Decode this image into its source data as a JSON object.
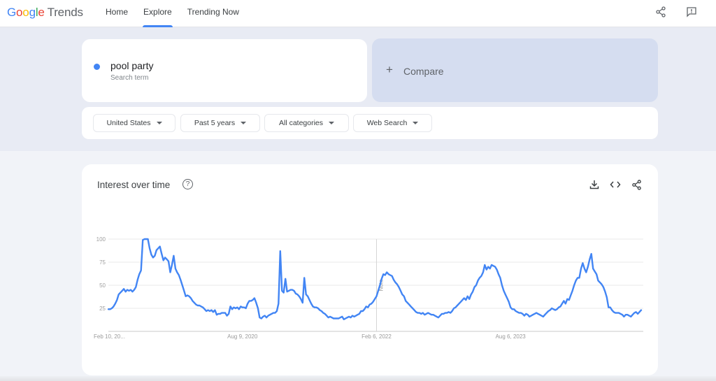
{
  "app": {
    "logo_google": [
      "G",
      "o",
      "o",
      "g",
      "l",
      "e"
    ],
    "logo_trends": "Trends"
  },
  "nav": {
    "items": [
      {
        "label": "Home",
        "active": false
      },
      {
        "label": "Explore",
        "active": true
      },
      {
        "label": "Trending Now",
        "active": false
      }
    ]
  },
  "header_icons": [
    "share-icon",
    "feedback-icon"
  ],
  "search": {
    "term": "pool party",
    "term_subtitle": "Search term",
    "term_color": "#4285f4",
    "compare_label": "Compare",
    "compare_icon": "+"
  },
  "filters": [
    {
      "label": "United States"
    },
    {
      "label": "Past 5 years"
    },
    {
      "label": "All categories"
    },
    {
      "label": "Web Search"
    }
  ],
  "chart_card": {
    "title": "Interest over time",
    "help_icon": "?",
    "actions": [
      "download-icon",
      "embed-icon",
      "share-icon"
    ]
  },
  "chart_data": {
    "type": "line",
    "title": "Interest over time",
    "xlabel": "",
    "ylabel": "",
    "ylim": [
      0,
      100
    ],
    "yticks": [
      25,
      50,
      75,
      100
    ],
    "xtick_labels": [
      "Feb 10, 20...",
      "Aug 9, 2020",
      "Feb 6, 2022",
      "Aug 6, 2023"
    ],
    "xtick_positions_week": [
      0,
      78,
      156,
      234
    ],
    "grid": true,
    "legend": "none",
    "annotation": {
      "label": "Note",
      "week": 156
    },
    "series": [
      {
        "name": "pool party",
        "color": "#4285f4",
        "frequency": "weekly",
        "start": "Feb 10, 2019",
        "values": [
          24,
          24,
          25,
          27,
          30,
          34,
          40,
          42,
          44,
          46,
          43,
          45,
          44,
          45,
          43,
          45,
          48,
          56,
          62,
          66,
          99,
          100,
          100,
          100,
          90,
          83,
          80,
          82,
          88,
          90,
          92,
          84,
          77,
          80,
          78,
          76,
          64,
          72,
          82,
          68,
          64,
          61,
          56,
          50,
          44,
          38,
          39,
          38,
          36,
          33,
          31,
          29,
          28,
          28,
          27,
          26,
          24,
          22,
          23,
          22,
          23,
          21,
          23,
          18,
          19,
          19,
          20,
          20,
          20,
          17,
          19,
          27,
          24,
          26,
          25,
          26,
          24,
          27,
          26,
          26,
          25,
          30,
          33,
          33,
          34,
          36,
          31,
          25,
          15,
          14,
          16,
          17,
          15,
          17,
          18,
          19,
          20,
          20,
          22,
          30,
          87,
          44,
          42,
          57,
          43,
          44,
          45,
          45,
          44,
          41,
          40,
          38,
          35,
          31,
          58,
          40,
          38,
          34,
          30,
          27,
          26,
          26,
          25,
          23,
          22,
          20,
          19,
          17,
          15,
          16,
          15,
          14,
          14,
          14,
          14,
          15,
          16,
          13,
          14,
          15,
          16,
          15,
          17,
          16,
          17,
          18,
          19,
          22,
          22,
          24,
          27,
          26,
          29,
          30,
          32,
          35,
          38,
          44,
          50,
          57,
          62,
          61,
          64,
          62,
          61,
          60,
          56,
          53,
          51,
          48,
          44,
          40,
          38,
          33,
          31,
          29,
          27,
          25,
          23,
          21,
          20,
          20,
          19,
          20,
          18,
          19,
          20,
          19,
          18,
          18,
          17,
          16,
          15,
          17,
          19,
          19,
          20,
          20,
          21,
          20,
          22,
          25,
          26,
          28,
          30,
          32,
          34,
          36,
          34,
          38,
          35,
          40,
          43,
          48,
          50,
          55,
          58,
          60,
          64,
          72,
          67,
          70,
          68,
          72,
          71,
          70,
          67,
          62,
          58,
          50,
          44,
          40,
          36,
          32,
          26,
          24,
          24,
          22,
          21,
          20,
          20,
          19,
          17,
          19,
          18,
          16,
          17,
          18,
          19,
          20,
          19,
          18,
          17,
          16,
          18,
          20,
          22,
          23,
          25,
          24,
          23,
          24,
          26,
          27,
          30,
          33,
          30,
          35,
          34,
          39,
          44,
          50,
          55,
          58,
          58,
          68,
          74,
          68,
          64,
          70,
          78,
          84,
          68,
          65,
          62,
          55,
          53,
          51,
          48,
          43,
          37,
          26,
          26,
          23,
          21,
          20,
          20,
          20,
          19,
          18,
          16,
          18,
          18,
          17,
          16,
          18,
          20,
          21,
          19,
          21,
          23
        ]
      }
    ]
  }
}
